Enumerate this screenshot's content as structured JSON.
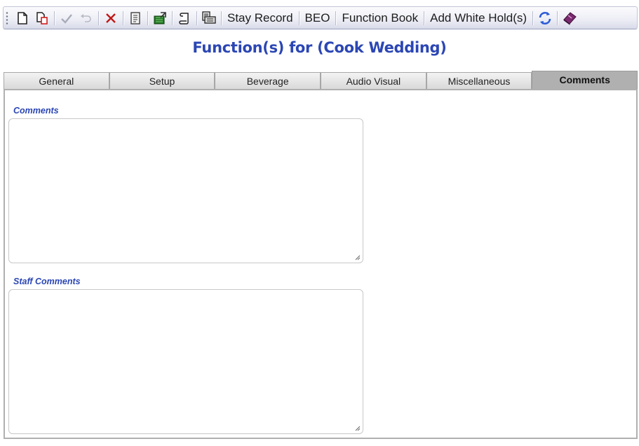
{
  "toolbar": {
    "icons": [
      "new-document-icon",
      "copy-document-icon",
      "save-check-icon",
      "undo-icon",
      "delete-icon",
      "report-icon",
      "export-icon",
      "scroll-icon",
      "print-icon",
      "refresh-icon",
      "book-icon"
    ],
    "stay_record_label": "Stay Record",
    "beo_label": "BEO",
    "function_book_label": "Function Book",
    "add_white_holds_label": "Add White Hold(s)"
  },
  "page_title": "Function(s) for (Cook Wedding)",
  "tabs": [
    {
      "label": "General",
      "active": false
    },
    {
      "label": "Setup",
      "active": false
    },
    {
      "label": "Beverage",
      "active": false
    },
    {
      "label": "Audio Visual",
      "active": false
    },
    {
      "label": "Miscellaneous",
      "active": false
    },
    {
      "label": "Comments",
      "active": true
    }
  ],
  "comments": {
    "label": "Comments",
    "value": ""
  },
  "staff_comments": {
    "label": "Staff Comments",
    "value": ""
  },
  "colors": {
    "title": "#2b46b4",
    "label": "#2b46b4",
    "active_tab": "#b0b0b0",
    "delete_icon": "#c01818",
    "refresh_icon": "#2a5bd7"
  }
}
